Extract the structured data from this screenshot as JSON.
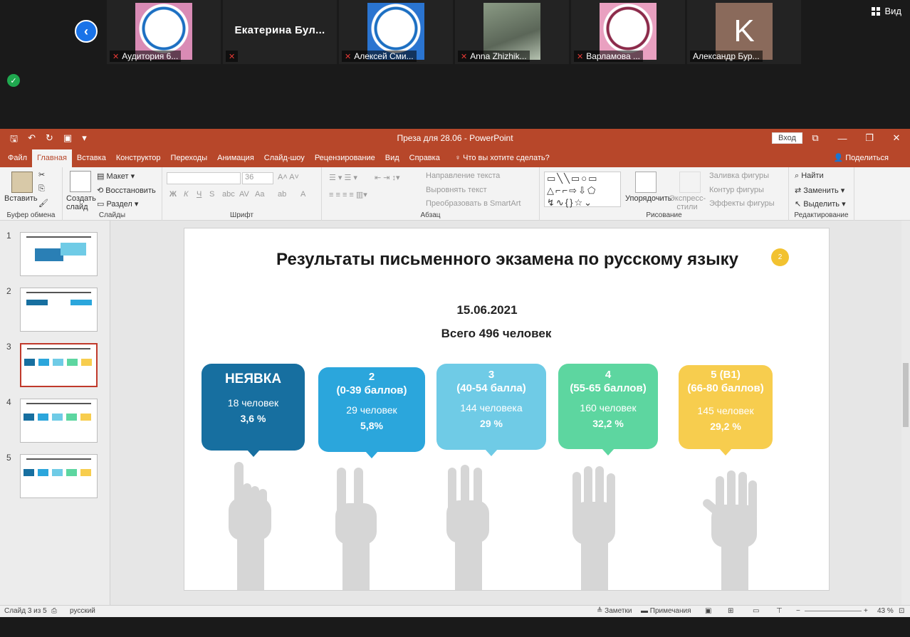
{
  "zoom": {
    "view_label": "Вид",
    "participants": [
      {
        "name": "Аудитория 6...",
        "muted": true,
        "avatar": "mgu-logo"
      },
      {
        "name": "Екатерина Бул...",
        "muted": true,
        "avatar": "name-only"
      },
      {
        "name": "Алексей Сми...",
        "muted": true,
        "avatar": "mgu-logo"
      },
      {
        "name": "Anna Zhizhik...",
        "muted": true,
        "avatar": "photo"
      },
      {
        "name": "Варламова ...",
        "muted": true,
        "avatar": "mgu-logo"
      },
      {
        "name": "Александр Бур...",
        "muted": false,
        "avatar": "letter",
        "letter": "K"
      }
    ]
  },
  "ppt": {
    "window_title": "Преза для 28.06 - PowerPoint",
    "signin_label": "Вход",
    "tabs": [
      "Файл",
      "Главная",
      "Вставка",
      "Конструктор",
      "Переходы",
      "Анимация",
      "Слайд-шоу",
      "Рецензирование",
      "Вид",
      "Справка"
    ],
    "active_tab": "Главная",
    "tell_me": "Что вы хотите сделать?",
    "share": "Поделиться",
    "ribbon": {
      "clipboard_group": "Буфер обмена",
      "paste": "Вставить",
      "slides_group": "Слайды",
      "new_slide": "Создать слайд",
      "layout": "Макет",
      "reset": "Восстановить",
      "section": "Раздел",
      "font_group": "Шрифт",
      "font_size": "36",
      "paragraph_group": "Абзац",
      "text_direction": "Направление текста",
      "align_text": "Выровнять текст",
      "smartart": "Преобразовать в SmartArt",
      "drawing_group": "Рисование",
      "arrange": "Упорядочить",
      "quick_styles": "Экспресс-стили",
      "shape_fill": "Заливка фигуры",
      "shape_outline": "Контур фигуры",
      "shape_effects": "Эффекты фигуры",
      "editing_group": "Редактирование",
      "find": "Найти",
      "replace": "Заменить",
      "select": "Выделить"
    },
    "thumbnails": [
      "1",
      "2",
      "3",
      "4",
      "5"
    ],
    "selected_slide": 3,
    "slide": {
      "title": "Результаты письменного экзамена по русскому языку",
      "badge": "2",
      "date": "15.06.2021",
      "total": "Всего 496 человек",
      "cards": [
        {
          "h1": "НЕЯВКА",
          "h2": "",
          "count": "18 человек",
          "pct": "3,6 %",
          "color": "#176fa0"
        },
        {
          "h1": "2",
          "h2": "(0-39 баллов)",
          "count": "29 человек",
          "pct": "5,8%",
          "color": "#2ba6dc"
        },
        {
          "h1": "3",
          "h2": "(40-54 балла)",
          "count": "144 человека",
          "pct": "29 %",
          "color": "#6fcbe6"
        },
        {
          "h1": "4",
          "h2": "(55-65 баллов)",
          "count": "160 человек",
          "pct": "32,2 %",
          "color": "#5dd6a0"
        },
        {
          "h1": "5 (В1)",
          "h2": "(66-80 баллов)",
          "count": "145 человек",
          "pct": "29,2 %",
          "color": "#f7cd4e"
        }
      ]
    },
    "status": {
      "slide_of": "Слайд 3 из 5",
      "language": "русский",
      "notes": "Заметки",
      "comments": "Примечания",
      "zoom": "43 %"
    }
  }
}
